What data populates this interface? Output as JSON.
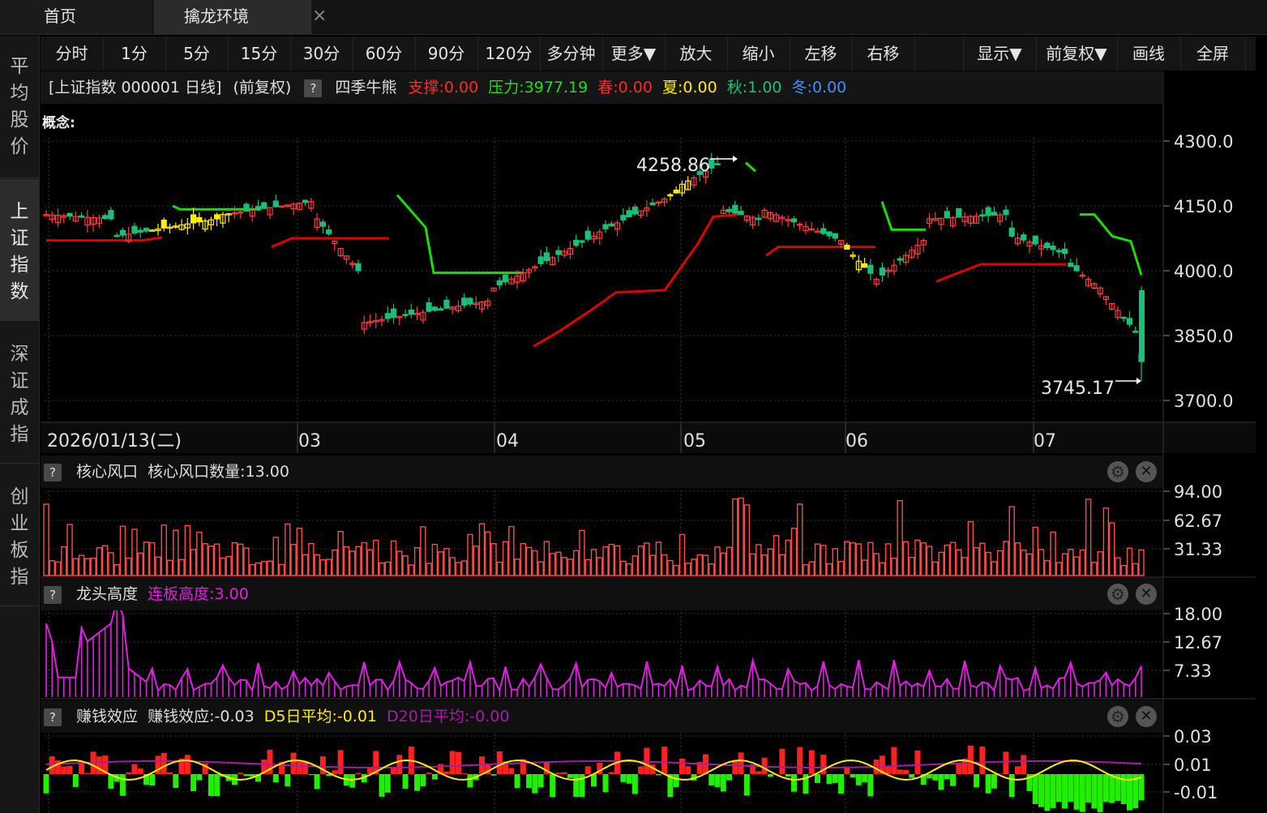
{
  "tabs": {
    "home": "首页",
    "env": "擒龙环境",
    "close": "×"
  },
  "left_nav": [
    {
      "label": "平均股价",
      "active": false
    },
    {
      "label": "上证指数",
      "active": true
    },
    {
      "label": "深证成指",
      "active": false
    },
    {
      "label": "创业板指",
      "active": false
    }
  ],
  "toolbar": [
    "分时",
    "1分",
    "5分",
    "15分",
    "30分",
    "60分",
    "90分",
    "120分",
    "多分钟",
    "更多▼",
    "放大",
    "缩小",
    "左移",
    "右移",
    "",
    "显示▼",
    "前复权▼",
    "画线",
    "全屏"
  ],
  "header": {
    "title": "[上证指数 000001 日线]",
    "adj": "(前复权)",
    "q": "?",
    "indicator": "四季牛熊",
    "support": "支撑:0.00",
    "pressure": "压力:3977.19",
    "spring": "春:0.00",
    "summer": "夏:0.00",
    "autumn": "秋:1.00",
    "winter": "冬:0.00"
  },
  "concept_label": "概念:",
  "price_axis": [
    "4300.0",
    "4150.0",
    "4000.0",
    "3850.0",
    "3700.0"
  ],
  "price_marks": {
    "high": "4258.86",
    "low": "3745.17"
  },
  "dates": {
    "first": "2026/01/13(二)",
    "m03": "03",
    "m04": "04",
    "m05": "05",
    "m06": "06",
    "m07": "07"
  },
  "panel1": {
    "q": "?",
    "title": "核心风口",
    "value": "核心风口数量:13.00",
    "axis": [
      "94.00",
      "62.67",
      "31.33"
    ]
  },
  "panel2": {
    "q": "?",
    "title": "龙头高度",
    "value": "连板高度:3.00",
    "axis": [
      "18.00",
      "12.67",
      "7.33"
    ]
  },
  "panel3": {
    "q": "?",
    "title": "赚钱效应",
    "value": "赚钱效应:-0.03",
    "d5": "D5日平均:-0.01",
    "d20": "D20日平均:-0.00",
    "axis": [
      "0.03",
      "0.01",
      "-0.01"
    ]
  },
  "icons": {
    "gear": "⚙",
    "close": "✕"
  },
  "colors": {
    "up": "#ff3b3b",
    "down": "#19c07a",
    "yellow": "#ffee00",
    "magenta": "#e020e0",
    "green_line": "#17e000",
    "red_line": "#e00000"
  }
}
